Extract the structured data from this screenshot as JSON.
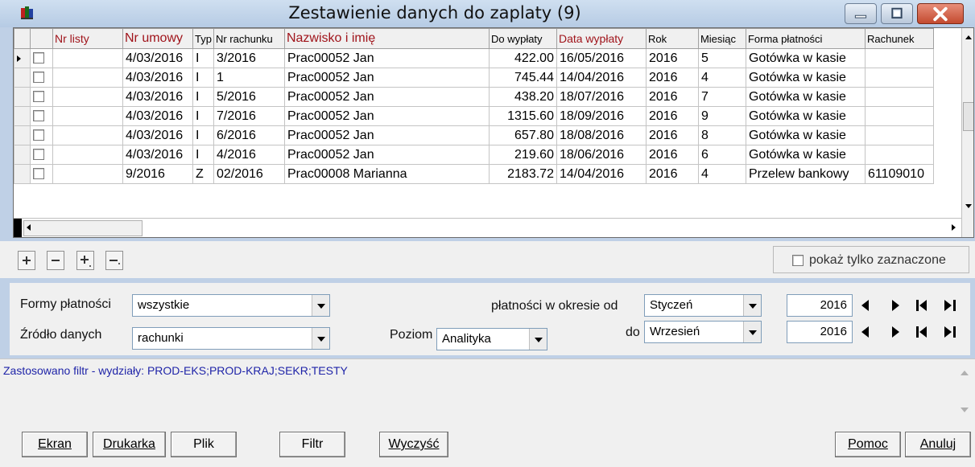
{
  "window": {
    "title": "Zestawienie danych do zaplaty (9)"
  },
  "grid": {
    "columns": [
      "Nr listy",
      "Nr umowy",
      "Typ",
      "Nr rachunku",
      "Nazwisko i imię",
      "Do wypłaty",
      "Data wypłaty",
      "Rok",
      "Miesiąc",
      "Forma płatności",
      "Rachunek"
    ],
    "rows": [
      [
        "",
        "4/03/2016",
        "I",
        "3/2016",
        "Prac00052 Jan",
        "422.00",
        "16/05/2016",
        "2016",
        "5",
        "Gotówka w kasie",
        ""
      ],
      [
        "",
        "4/03/2016",
        "I",
        "1",
        "Prac00052 Jan",
        "745.44",
        "14/04/2016",
        "2016",
        "4",
        "Gotówka w kasie",
        ""
      ],
      [
        "",
        "4/03/2016",
        "I",
        "5/2016",
        "Prac00052 Jan",
        "438.20",
        "18/07/2016",
        "2016",
        "7",
        "Gotówka w kasie",
        ""
      ],
      [
        "",
        "4/03/2016",
        "I",
        "7/2016",
        "Prac00052 Jan",
        "1315.60",
        "18/09/2016",
        "2016",
        "9",
        "Gotówka w kasie",
        ""
      ],
      [
        "",
        "4/03/2016",
        "I",
        "6/2016",
        "Prac00052 Jan",
        "657.80",
        "18/08/2016",
        "2016",
        "8",
        "Gotówka w kasie",
        ""
      ],
      [
        "",
        "4/03/2016",
        "I",
        "4/2016",
        "Prac00052 Jan",
        "219.60",
        "18/06/2016",
        "2016",
        "6",
        "Gotówka w kasie",
        ""
      ],
      [
        "",
        "9/2016",
        "Z",
        "02/2016",
        "Prac00008 Marianna",
        "2183.72",
        "14/04/2016",
        "2016",
        "4",
        "Przelew bankowy",
        "61109010"
      ]
    ]
  },
  "toolbar": {
    "add_icon": "plus-icon",
    "remove_icon": "minus-icon",
    "show_only_selected_label": "pokaż tylko zaznaczone"
  },
  "filters": {
    "payment_forms_label": "Formy płatności",
    "payment_forms_value": "wszystkie",
    "data_source_label": "Źródło danych",
    "data_source_value": "rachunki",
    "level_label": "Poziom",
    "level_value": "Analityka",
    "period_from_label": "płatności w okresie od",
    "period_from_month": "Styczeń",
    "period_from_year": "2016",
    "period_to_label": "do",
    "period_to_month": "Wrzesień",
    "period_to_year": "2016"
  },
  "info": {
    "text": "Zastosowano filtr - wydziały: PROD-EKS;PROD-KRAJ;SEKR;TESTY"
  },
  "buttons": {
    "screen": "Ekran",
    "printer": "Drukarka",
    "file": "Plik",
    "filter": "Filtr",
    "clear": "Wyczyść",
    "help": "Pomoc",
    "cancel": "Anuluj"
  },
  "colors": {
    "header_red": "#a0141b",
    "info_blue": "#1f24a8",
    "close_red": "#c34a2f"
  }
}
